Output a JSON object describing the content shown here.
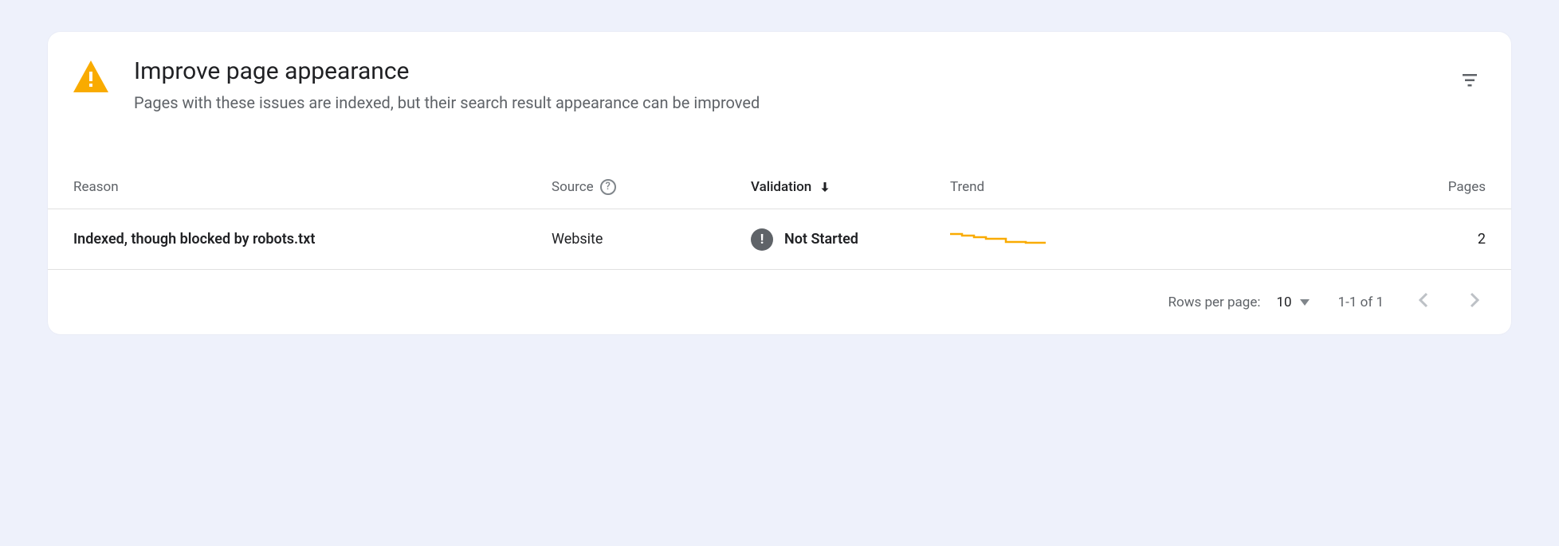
{
  "header": {
    "title": "Improve page appearance",
    "subtitle": "Pages with these issues are indexed, but their search result appearance can be improved"
  },
  "table": {
    "columns": {
      "reason": "Reason",
      "source": "Source",
      "validation": "Validation",
      "trend": "Trend",
      "pages": "Pages"
    },
    "rows": [
      {
        "reason": "Indexed, though blocked by robots.txt",
        "source": "Website",
        "validation": "Not Started",
        "pages": "2"
      }
    ]
  },
  "pagination": {
    "rowsLabel": "Rows per page:",
    "rowsValue": "10",
    "range": "1-1 of 1"
  },
  "chart_data": {
    "type": "line",
    "title": "",
    "xlabel": "",
    "ylabel": "",
    "series": [
      {
        "name": "trend",
        "values": [
          5,
          5,
          4,
          4,
          3,
          3,
          3,
          3,
          2,
          2,
          2
        ]
      }
    ],
    "ylim": [
      0,
      6
    ]
  }
}
